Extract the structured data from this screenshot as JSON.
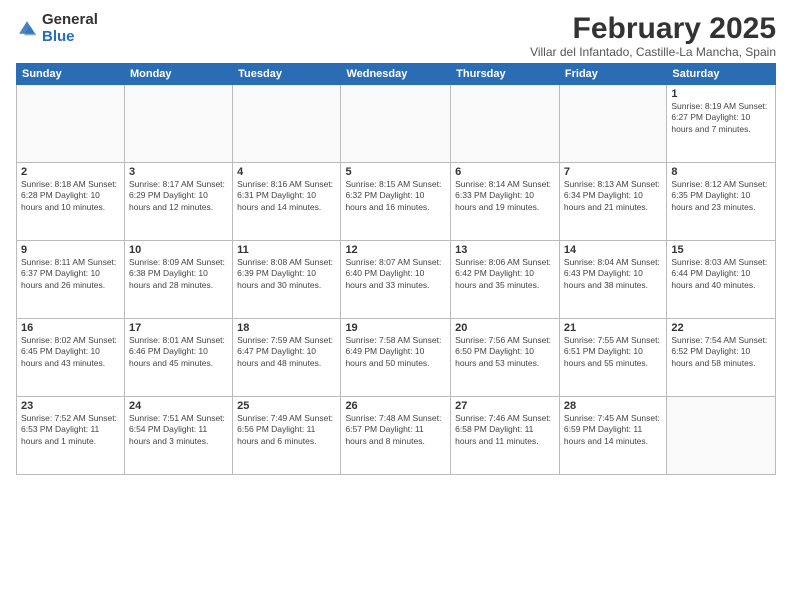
{
  "logo": {
    "general": "General",
    "blue": "Blue"
  },
  "title": "February 2025",
  "subtitle": "Villar del Infantado, Castille-La Mancha, Spain",
  "weekdays": [
    "Sunday",
    "Monday",
    "Tuesday",
    "Wednesday",
    "Thursday",
    "Friday",
    "Saturday"
  ],
  "weeks": [
    [
      {
        "day": "",
        "info": ""
      },
      {
        "day": "",
        "info": ""
      },
      {
        "day": "",
        "info": ""
      },
      {
        "day": "",
        "info": ""
      },
      {
        "day": "",
        "info": ""
      },
      {
        "day": "",
        "info": ""
      },
      {
        "day": "1",
        "info": "Sunrise: 8:19 AM\nSunset: 6:27 PM\nDaylight: 10 hours and 7 minutes."
      }
    ],
    [
      {
        "day": "2",
        "info": "Sunrise: 8:18 AM\nSunset: 6:28 PM\nDaylight: 10 hours and 10 minutes."
      },
      {
        "day": "3",
        "info": "Sunrise: 8:17 AM\nSunset: 6:29 PM\nDaylight: 10 hours and 12 minutes."
      },
      {
        "day": "4",
        "info": "Sunrise: 8:16 AM\nSunset: 6:31 PM\nDaylight: 10 hours and 14 minutes."
      },
      {
        "day": "5",
        "info": "Sunrise: 8:15 AM\nSunset: 6:32 PM\nDaylight: 10 hours and 16 minutes."
      },
      {
        "day": "6",
        "info": "Sunrise: 8:14 AM\nSunset: 6:33 PM\nDaylight: 10 hours and 19 minutes."
      },
      {
        "day": "7",
        "info": "Sunrise: 8:13 AM\nSunset: 6:34 PM\nDaylight: 10 hours and 21 minutes."
      },
      {
        "day": "8",
        "info": "Sunrise: 8:12 AM\nSunset: 6:35 PM\nDaylight: 10 hours and 23 minutes."
      }
    ],
    [
      {
        "day": "9",
        "info": "Sunrise: 8:11 AM\nSunset: 6:37 PM\nDaylight: 10 hours and 26 minutes."
      },
      {
        "day": "10",
        "info": "Sunrise: 8:09 AM\nSunset: 6:38 PM\nDaylight: 10 hours and 28 minutes."
      },
      {
        "day": "11",
        "info": "Sunrise: 8:08 AM\nSunset: 6:39 PM\nDaylight: 10 hours and 30 minutes."
      },
      {
        "day": "12",
        "info": "Sunrise: 8:07 AM\nSunset: 6:40 PM\nDaylight: 10 hours and 33 minutes."
      },
      {
        "day": "13",
        "info": "Sunrise: 8:06 AM\nSunset: 6:42 PM\nDaylight: 10 hours and 35 minutes."
      },
      {
        "day": "14",
        "info": "Sunrise: 8:04 AM\nSunset: 6:43 PM\nDaylight: 10 hours and 38 minutes."
      },
      {
        "day": "15",
        "info": "Sunrise: 8:03 AM\nSunset: 6:44 PM\nDaylight: 10 hours and 40 minutes."
      }
    ],
    [
      {
        "day": "16",
        "info": "Sunrise: 8:02 AM\nSunset: 6:45 PM\nDaylight: 10 hours and 43 minutes."
      },
      {
        "day": "17",
        "info": "Sunrise: 8:01 AM\nSunset: 6:46 PM\nDaylight: 10 hours and 45 minutes."
      },
      {
        "day": "18",
        "info": "Sunrise: 7:59 AM\nSunset: 6:47 PM\nDaylight: 10 hours and 48 minutes."
      },
      {
        "day": "19",
        "info": "Sunrise: 7:58 AM\nSunset: 6:49 PM\nDaylight: 10 hours and 50 minutes."
      },
      {
        "day": "20",
        "info": "Sunrise: 7:56 AM\nSunset: 6:50 PM\nDaylight: 10 hours and 53 minutes."
      },
      {
        "day": "21",
        "info": "Sunrise: 7:55 AM\nSunset: 6:51 PM\nDaylight: 10 hours and 55 minutes."
      },
      {
        "day": "22",
        "info": "Sunrise: 7:54 AM\nSunset: 6:52 PM\nDaylight: 10 hours and 58 minutes."
      }
    ],
    [
      {
        "day": "23",
        "info": "Sunrise: 7:52 AM\nSunset: 6:53 PM\nDaylight: 11 hours and 1 minute."
      },
      {
        "day": "24",
        "info": "Sunrise: 7:51 AM\nSunset: 6:54 PM\nDaylight: 11 hours and 3 minutes."
      },
      {
        "day": "25",
        "info": "Sunrise: 7:49 AM\nSunset: 6:56 PM\nDaylight: 11 hours and 6 minutes."
      },
      {
        "day": "26",
        "info": "Sunrise: 7:48 AM\nSunset: 6:57 PM\nDaylight: 11 hours and 8 minutes."
      },
      {
        "day": "27",
        "info": "Sunrise: 7:46 AM\nSunset: 6:58 PM\nDaylight: 11 hours and 11 minutes."
      },
      {
        "day": "28",
        "info": "Sunrise: 7:45 AM\nSunset: 6:59 PM\nDaylight: 11 hours and 14 minutes."
      },
      {
        "day": "",
        "info": ""
      }
    ]
  ]
}
